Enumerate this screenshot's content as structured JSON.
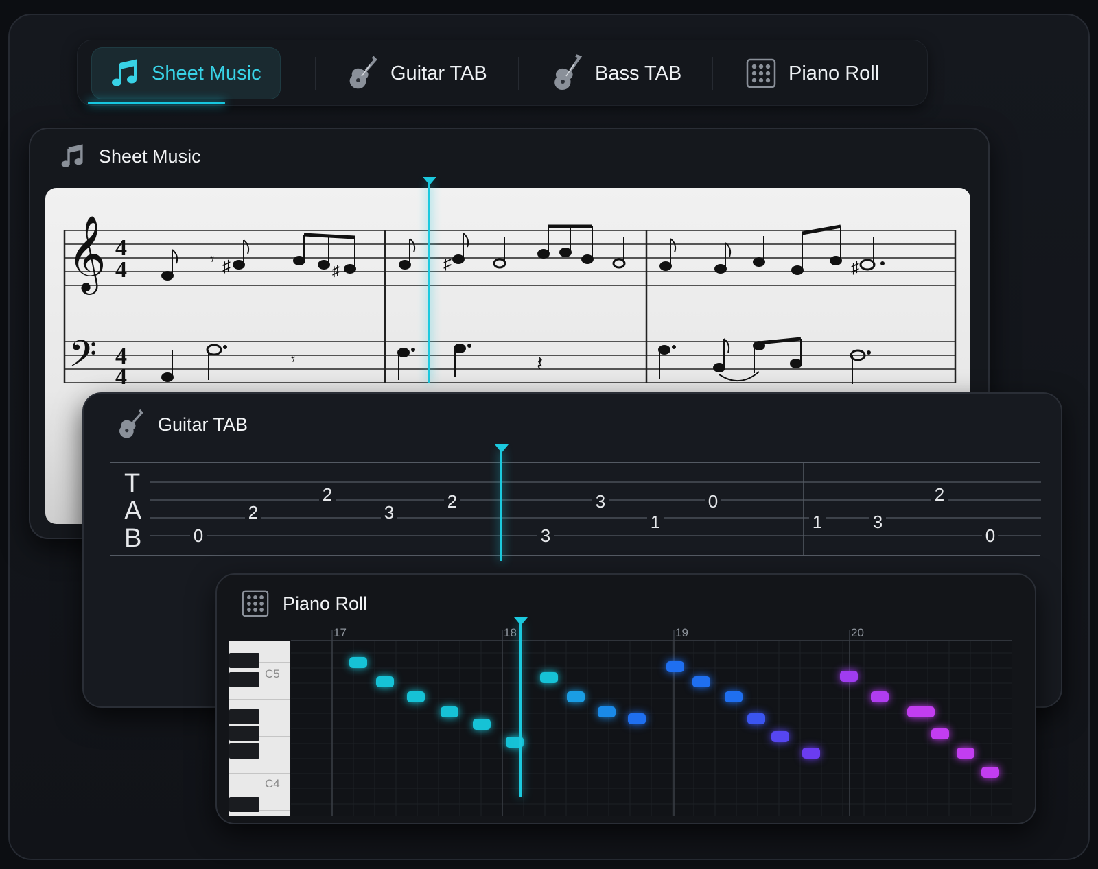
{
  "tabs": [
    {
      "label": "Sheet Music",
      "icon": "music-note-icon",
      "active": true
    },
    {
      "label": "Guitar TAB",
      "icon": "guitar-icon",
      "active": false
    },
    {
      "label": "Bass TAB",
      "icon": "bass-guitar-icon",
      "active": false
    },
    {
      "label": "Piano Roll",
      "icon": "grid-dots-icon",
      "active": false
    }
  ],
  "sheet_music": {
    "title": "Sheet Music",
    "time_signature": "4/4",
    "treble_clef": "𝄞",
    "bass_clef": "𝄢"
  },
  "guitar_tab": {
    "title": "Guitar TAB",
    "letters": [
      "T",
      "A",
      "B"
    ],
    "notes": [
      {
        "fret": "0",
        "string": 5,
        "beat": 1
      },
      {
        "fret": "2",
        "string": 3,
        "beat": 2
      },
      {
        "fret": "2",
        "string": 2,
        "beat": 3
      },
      {
        "fret": "3",
        "string": 3,
        "beat": 4
      },
      {
        "fret": "2",
        "string": 2.4,
        "beat": 5
      },
      {
        "fret": "3",
        "string": 5,
        "beat": 6
      },
      {
        "fret": "3",
        "string": 2.4,
        "beat": 7
      },
      {
        "fret": "1",
        "string": 4,
        "beat": 8
      },
      {
        "fret": "0",
        "string": 2.4,
        "beat": 9
      },
      {
        "fret": "1",
        "string": 4,
        "beat": 10
      },
      {
        "fret": "3",
        "string": 4,
        "beat": 11
      },
      {
        "fret": "2",
        "string": 2,
        "beat": 12
      },
      {
        "fret": "0",
        "string": 5,
        "beat": 13
      }
    ]
  },
  "piano_roll": {
    "title": "Piano Roll",
    "bar_labels": [
      "17",
      "18",
      "19",
      "20"
    ],
    "key_labels": [
      "C5",
      "C4"
    ]
  },
  "colors": {
    "accent": "#17c7e0",
    "cyan_notes": "#16c2d6",
    "blue_notes": "#1f6ff0",
    "violet_notes": "#6b3cf0",
    "magenta_notes": "#c23df0"
  }
}
